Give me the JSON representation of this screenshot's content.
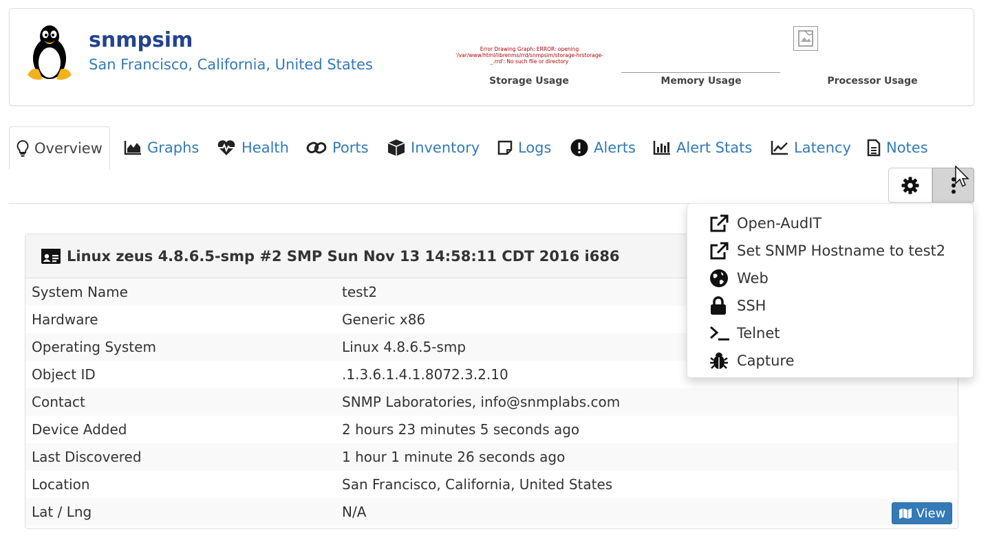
{
  "header": {
    "device_name": "snmpsim",
    "device_location": "San Francisco, California, United States",
    "graph_error": "Error Drawing Graph: ERROR: opening '/var/www/html/librenms/rrd/snmpsim/storage-hrstorage-_.rrd': No such file or directory",
    "graphs": [
      {
        "label": "Storage Usage"
      },
      {
        "label": "Memory Usage"
      },
      {
        "label": "Processor Usage"
      }
    ],
    "logo_icon": "linux-tux-icon"
  },
  "tabs": [
    {
      "label": "Overview",
      "icon": "lightbulb-icon",
      "active": true
    },
    {
      "label": "Graphs",
      "icon": "area-chart-icon"
    },
    {
      "label": "Health",
      "icon": "heartbeat-icon"
    },
    {
      "label": "Ports",
      "icon": "link-icon"
    },
    {
      "label": "Inventory",
      "icon": "cube-icon"
    },
    {
      "label": "Logs",
      "icon": "sticky-note-icon"
    },
    {
      "label": "Alerts",
      "icon": "exclamation-circle-icon"
    },
    {
      "label": "Alert Stats",
      "icon": "bar-chart-icon"
    },
    {
      "label": "Latency",
      "icon": "line-chart-icon"
    },
    {
      "label": "Notes",
      "icon": "file-text-icon"
    }
  ],
  "overview": {
    "title": "Linux zeus 4.8.6.5-smp #2 SMP Sun Nov 13 14:58:11 CDT 2016 i686",
    "rows": [
      {
        "label": "System Name",
        "value": "test2"
      },
      {
        "label": "Hardware",
        "value": "Generic x86"
      },
      {
        "label": "Operating System",
        "value": "Linux 4.8.6.5-smp"
      },
      {
        "label": "Object ID",
        "value": ".1.3.6.1.4.1.8072.3.2.10"
      },
      {
        "label": "Contact",
        "value": "SNMP Laboratories, info@snmplabs.com"
      },
      {
        "label": "Device Added",
        "value": "2 hours 23 minutes 5 seconds ago"
      },
      {
        "label": "Last Discovered",
        "value": "1 hour 1 minute 26 seconds ago"
      },
      {
        "label": "Location",
        "value": "San Francisco, California, United States"
      },
      {
        "label": "Lat / Lng",
        "value": "N/A"
      }
    ],
    "view_button": "View"
  },
  "dropdown": {
    "items": [
      {
        "label": "Open-AudIT",
        "icon": "external-link-icon"
      },
      {
        "label": "Set SNMP Hostname to test2",
        "icon": "external-link-icon"
      },
      {
        "label": "Web",
        "icon": "globe-icon"
      },
      {
        "label": "SSH",
        "icon": "lock-icon"
      },
      {
        "label": "Telnet",
        "icon": "terminal-icon"
      },
      {
        "label": "Capture",
        "icon": "bug-icon"
      }
    ]
  },
  "colors": {
    "link": "#337ab7",
    "device_name": "#23438f",
    "error_text": "#b00000",
    "primary_button": "#337ab7"
  }
}
